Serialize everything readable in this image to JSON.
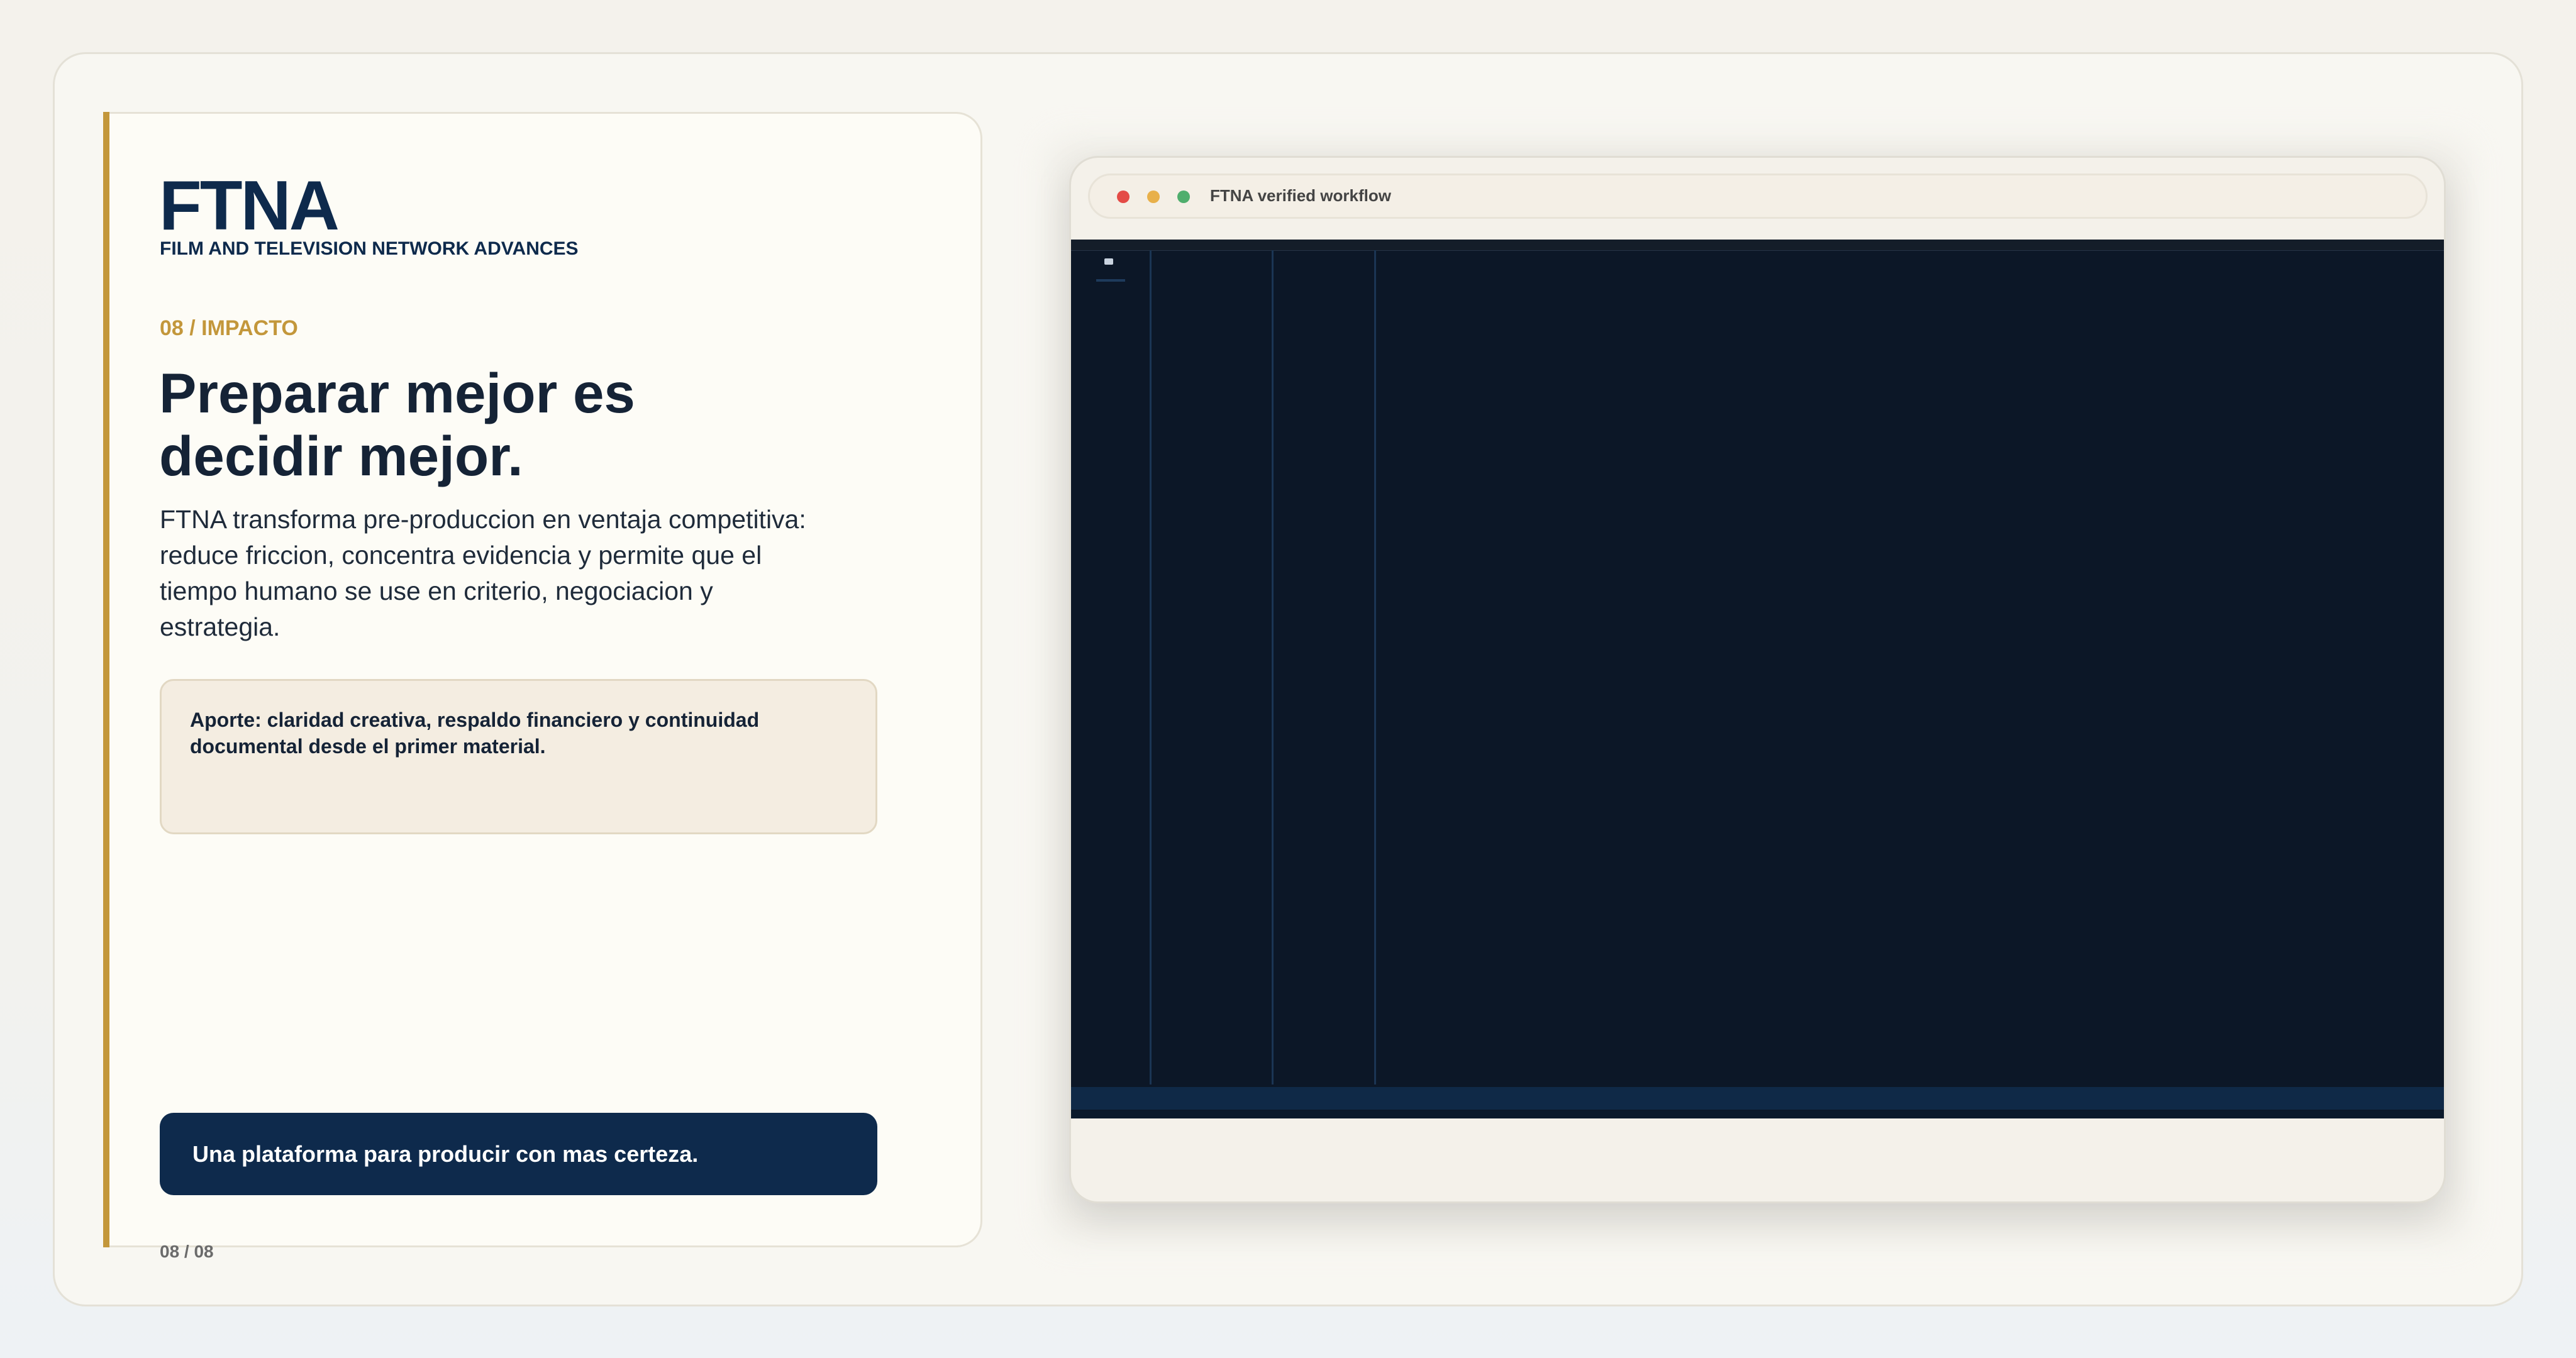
{
  "brand": {
    "name": "FTNA",
    "subtitle": "FILM AND TELEVISION NETWORK ADVANCES"
  },
  "slide": {
    "kicker": "08 / IMPACTO",
    "headline": "Preparar mejor es decidir mejor.",
    "lead": "FTNA transforma pre-produccion en ventaja competitiva: reduce friccion, concentra evidencia y permite que el tiempo humano se use en criterio, negociacion y estrategia.",
    "note": "Aporte: claridad creativa, respaldo financiero y continuidad documental desde el primer material.",
    "cta": "Una plataforma para producir con mas certeza.",
    "pager": "08 / 08"
  },
  "browser": {
    "title": "FTNA verified workflow"
  },
  "colors": {
    "accent": "#c3973b",
    "navy": "#0e2a4c",
    "app_background": "#0c1727",
    "traffic_red": "#e44b46",
    "traffic_yellow": "#e8b04a",
    "traffic_green": "#4fae6d"
  }
}
